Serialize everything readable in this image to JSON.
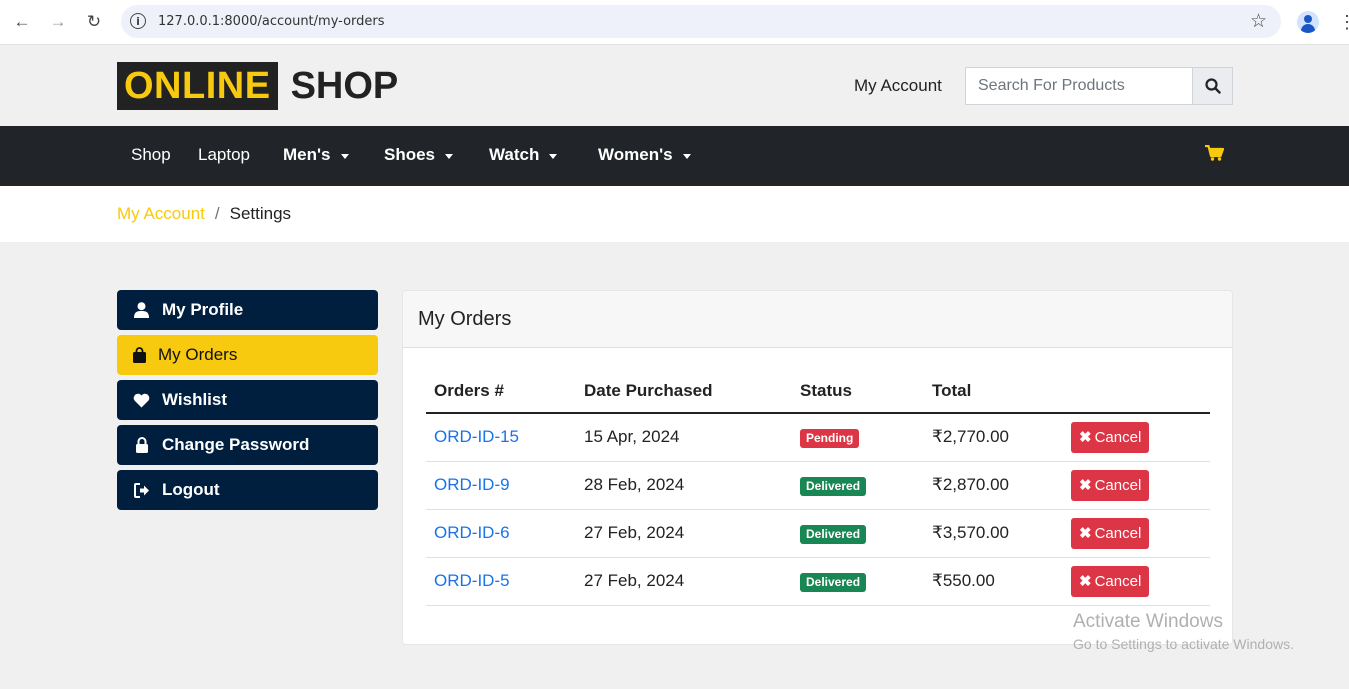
{
  "browser": {
    "url": "127.0.0.1:8000/account/my-orders",
    "back_icon": "←",
    "forward_icon": "→",
    "reload_icon": "↻",
    "info_icon": "i",
    "star_icon": "☆",
    "menu_icon": "⋮"
  },
  "header": {
    "logo_highlight": "ONLINE",
    "logo_text": "SHOP",
    "my_account": "My Account",
    "search_placeholder": "Search For Products"
  },
  "navbar": {
    "items": [
      {
        "label": "Shop",
        "dropdown": false
      },
      {
        "label": "Laptop",
        "dropdown": false
      },
      {
        "label": "Men's",
        "dropdown": true
      },
      {
        "label": "Shoes",
        "dropdown": true
      },
      {
        "label": "Watch",
        "dropdown": true
      },
      {
        "label": "Women's",
        "dropdown": true
      }
    ]
  },
  "breadcrumb": {
    "link": "My Account",
    "separator": "/",
    "current": "Settings"
  },
  "sidebar": {
    "items": [
      {
        "label": "My Profile",
        "icon": "user-icon"
      },
      {
        "label": "My Orders",
        "icon": "shopping-bag-icon"
      },
      {
        "label": "Wishlist",
        "icon": "heart-icon"
      },
      {
        "label": "Change Password",
        "icon": "lock-icon"
      },
      {
        "label": "Logout",
        "icon": "logout-icon"
      }
    ]
  },
  "orders": {
    "title": "My Orders",
    "columns": [
      "Orders #",
      "Date Purchased",
      "Status",
      "Total"
    ],
    "cancel_label": "Cancel",
    "rows": [
      {
        "id": "ORD-ID-15",
        "date": "15 Apr, 2024",
        "status": "Pending",
        "total": "₹2,770.00"
      },
      {
        "id": "ORD-ID-9",
        "date": "28 Feb, 2024",
        "status": "Delivered",
        "total": "₹2,870.00"
      },
      {
        "id": "ORD-ID-6",
        "date": "27 Feb, 2024",
        "status": "Delivered",
        "total": "₹3,570.00"
      },
      {
        "id": "ORD-ID-5",
        "date": "27 Feb, 2024",
        "status": "Delivered",
        "total": "₹550.00"
      }
    ]
  },
  "watermark": {
    "line1": "Activate Windows",
    "line2": "Go to Settings to activate Windows."
  },
  "colors": {
    "brand_yellow": "#f7c90f",
    "navy": "#001f3f",
    "navbar_dark": "#212529",
    "danger": "#dc3545",
    "success": "#198754",
    "link_blue": "#1a73e8"
  }
}
